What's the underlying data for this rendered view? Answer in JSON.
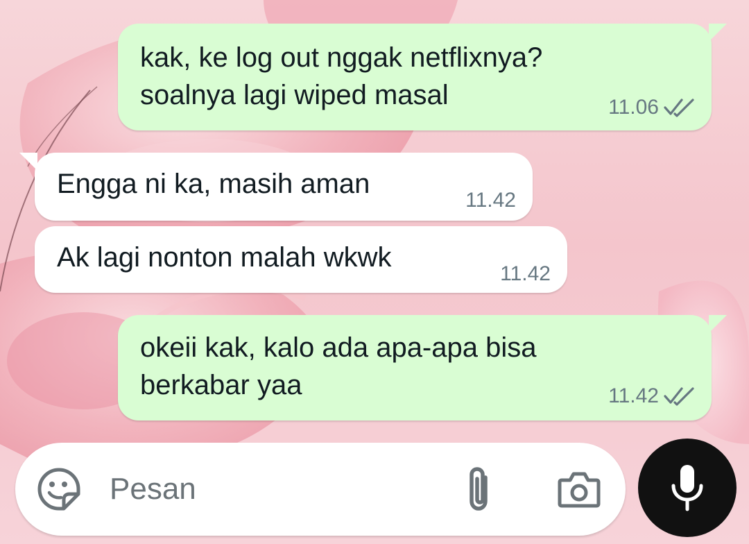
{
  "messages": [
    {
      "direction": "out",
      "lines": [
        "kak, ke log out nggak netflixnya?",
        "soalnya lagi wiped masal"
      ],
      "time": "11.06",
      "status": "read"
    },
    {
      "direction": "in",
      "lines": [
        "Engga ni ka, masih aman"
      ],
      "time": "11.42"
    },
    {
      "direction": "in",
      "lines": [
        "Ak lagi nonton malah wkwk"
      ],
      "time": "11.42"
    },
    {
      "direction": "out",
      "lines": [
        "okeii kak, kalo ada apa-apa bisa",
        "berkabar yaa"
      ],
      "time": "11.42",
      "status": "read"
    }
  ],
  "composer": {
    "placeholder": "Pesan",
    "left_icon": "sticker-emoji-icon",
    "attach_icon": "paperclip-icon",
    "camera_icon": "camera-icon"
  },
  "mic_button": {
    "icon": "microphone-icon"
  },
  "colors": {
    "outgoing_bubble": "#d9fdd3",
    "incoming_bubble": "#ffffff",
    "meta_text": "#667781",
    "message_text": "#111b21",
    "mic_button": "#111111"
  }
}
